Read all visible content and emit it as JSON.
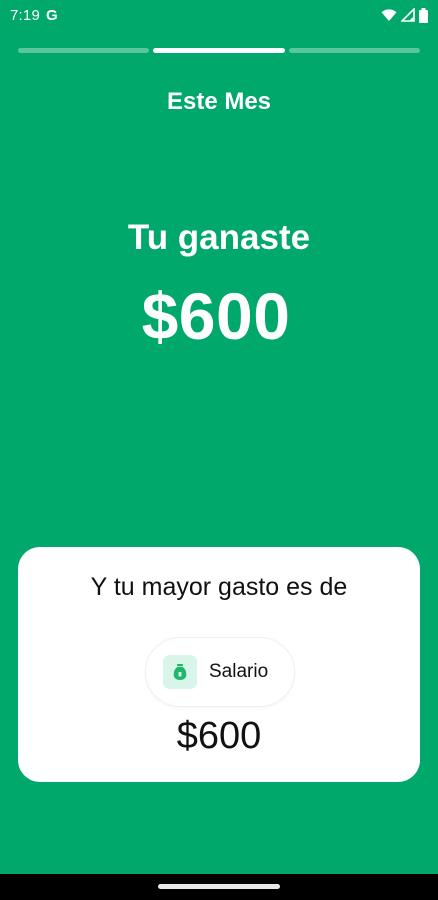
{
  "status_bar": {
    "time": "7:19",
    "google_letter": "G",
    "icons": [
      "wifi-icon",
      "signal-icon",
      "battery-icon"
    ]
  },
  "progress": {
    "segments": 3,
    "active_index": 1
  },
  "header": {
    "title": "Este Mes"
  },
  "summary": {
    "earned_label": "Tu ganaste",
    "earned_amount": "$600"
  },
  "card": {
    "title": "Y tu mayor gasto es de",
    "category": {
      "label": "Salario",
      "icon": "money-bag-icon"
    },
    "amount": "$600"
  },
  "colors": {
    "background": "#00a86b",
    "accent_light": "#d9f4e8",
    "icon_green": "#1fb86a",
    "card": "#ffffff"
  }
}
